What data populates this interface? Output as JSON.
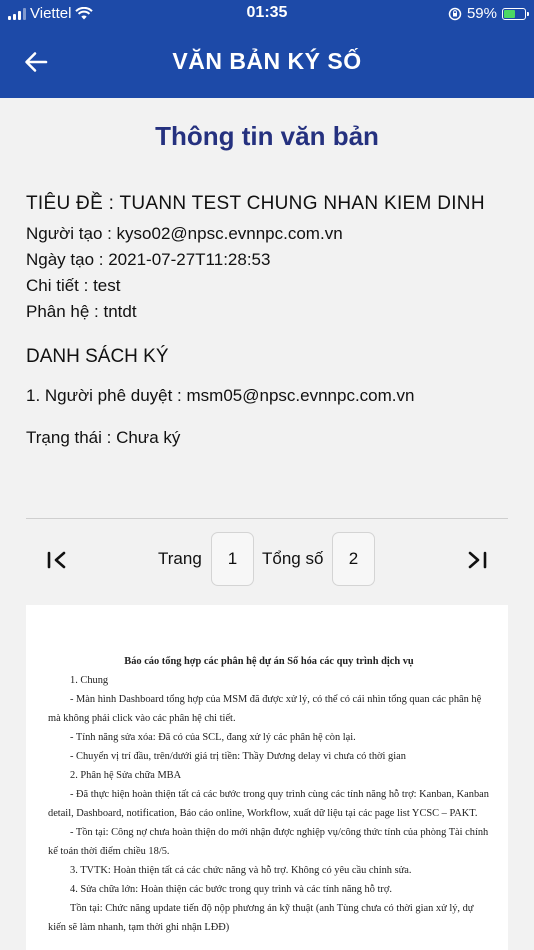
{
  "status_bar": {
    "carrier": "Viettel",
    "time": "01:35",
    "battery_percent": "59%",
    "battery_level": 0.59
  },
  "nav": {
    "title": "VĂN BẢN KÝ SỐ",
    "back_icon": "arrow-left-icon"
  },
  "section_title": "Thông tin văn bản",
  "info": {
    "title_line": "TIÊU ĐỀ : TUANN TEST CHUNG NHAN KIEM DINH",
    "creator": "Người tạo : kyso02@npsc.evnnpc.com.vn",
    "created_date": "Ngày tạo :  2021-07-27T11:28:53",
    "detail": "Chi tiết :  test",
    "subsystem": "Phân hệ : tntdt"
  },
  "sign_list": {
    "heading": "DANH SÁCH KÝ",
    "signer": "1. Người phê duyệt : msm05@npsc.evnnpc.com.vn",
    "status": "Trạng thái : Chưa ký"
  },
  "pager": {
    "page_label": "Trang",
    "page": "1",
    "total_label": "Tổng số",
    "total": "2"
  },
  "document": {
    "title": "Báo cáo tổng hợp các phân hệ dự án Số hóa các quy trình dịch vụ",
    "lines": [
      "1. Chung",
      "- Màn hình Dashboard tổng hợp của MSM đã được xử lý, có thể có cái nhìn tổng quan các phân hệ mà không phải click vào các phân hệ chi tiết.",
      "- Tính năng sửa xóa: Đã có của SCL, đang xử lý các phân hệ còn lại.",
      "- Chuyển vị trí đầu, trên/dưới giá trị tiền: Thầy Dương delay vì chưa có thời gian",
      "2. Phân hệ Sửa chữa MBA",
      "- Đã thực hiện hoàn thiện tất cả các bước trong quy trình cùng các tính năng hỗ trợ: Kanban, Kanban detail, Dashboard, notification, Báo cáo online, Workflow, xuất dữ liệu tại các page list YCSC – PAKT.",
      "- Tồn tại: Công nợ chưa hoàn thiện do mới nhận được nghiệp vụ/công thức tính của phòng Tài chính kế toán thời điểm chiều 18/5.",
      "3. TVTK: Hoàn thiện tất cả các chức năng và hỗ trợ. Không có yêu cầu chỉnh sửa.",
      "4. Sửa chữa lớn: Hoàn thiện các bước trong quy trình và các tính năng hỗ trợ.",
      "Tồn tại: Chức năng update tiến độ nộp phương án kỹ thuật (anh Tùng chưa có thời gian xử lý, dự kiến sẽ làm nhanh, tạm thời ghi nhận LĐĐ)"
    ]
  }
}
